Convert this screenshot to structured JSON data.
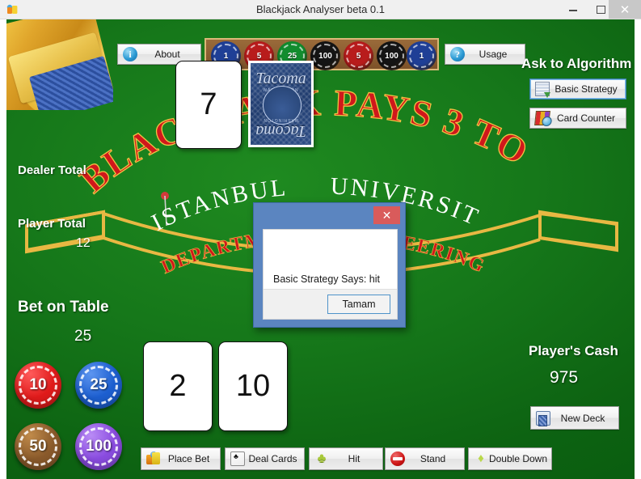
{
  "window": {
    "title": "Blackjack Analyser beta 0.1",
    "icon": "app-chips-icon",
    "minimize_label": "–",
    "maximize_label": "□",
    "close_label": "✕"
  },
  "toolbar": {
    "about_label": "About",
    "about_icon": "info-icon",
    "usage_label": "Usage",
    "usage_icon": "question-icon"
  },
  "rack": {
    "chips": [
      {
        "value": "1",
        "color": "#1f3f96"
      },
      {
        "value": "5",
        "color": "#b81c1c"
      },
      {
        "value": "25",
        "color": "#128c2e"
      },
      {
        "value": "100",
        "color": "#141414"
      },
      {
        "value": "5",
        "color": "#b81c1c"
      },
      {
        "value": "100",
        "color": "#141414"
      },
      {
        "value": "1",
        "color": "#1f3f96"
      }
    ]
  },
  "algorithm_panel": {
    "heading": "Ask to Algorithm",
    "basic_strategy_label": "Basic Strategy",
    "basic_strategy_icon": "table-grid-icon",
    "card_counter_label": "Card Counter",
    "card_counter_icon": "color-cards-icon"
  },
  "table_art": {
    "pays_text": "BLACKJACK PAYS 3 TO 2",
    "university_text": "ISTANBUL     UNIVERSITY",
    "department_text": "DEPARTMENT    ENGINEERING"
  },
  "dealer": {
    "total_label": "Dealer Total",
    "total_value": "",
    "cards": [
      {
        "rank": "7",
        "face_up": true
      },
      {
        "face_up": false,
        "back_word": "Tacoma",
        "back_sub": "WASHINGTON"
      }
    ]
  },
  "player": {
    "total_label": "Player Total",
    "total_value": "12",
    "cards": [
      {
        "rank": "2"
      },
      {
        "rank": "10"
      }
    ]
  },
  "bet": {
    "label": "Bet on Table",
    "value": "25",
    "chips": [
      {
        "value": "10",
        "color": "#e01b1b",
        "light": "#ff5a5a"
      },
      {
        "value": "25",
        "color": "#1d5fd0",
        "light": "#5d95f0"
      },
      {
        "value": "50",
        "color": "#8a5a2b",
        "light": "#c08a4a"
      },
      {
        "value": "100",
        "color": "#8a4ce0",
        "light": "#b98bf5"
      }
    ]
  },
  "cash": {
    "label": "Player's Cash",
    "value": "975",
    "new_deck_label": "New Deck",
    "new_deck_icon": "deck-icon"
  },
  "actions": [
    {
      "label": "Place Bet",
      "icon": "chips-icon"
    },
    {
      "label": "Deal Cards",
      "icon": "card-icon"
    },
    {
      "label": "Hit",
      "icon": "clover-icon"
    },
    {
      "label": "Stand",
      "icon": "stop-icon"
    },
    {
      "label": "Double Down",
      "icon": "leaf-icon"
    }
  ],
  "dialog": {
    "message": "Basic Strategy Says: hit",
    "ok_label": "Tamam",
    "close_label": "✕",
    "titlebar_color": "#5b85c0",
    "close_color": "#d95b5b"
  },
  "colors": {
    "felt_green": "#16781a",
    "felt_green_dark": "#085a0e",
    "accent_red": "#c41a1a",
    "accent_gold": "#e3b23c"
  }
}
